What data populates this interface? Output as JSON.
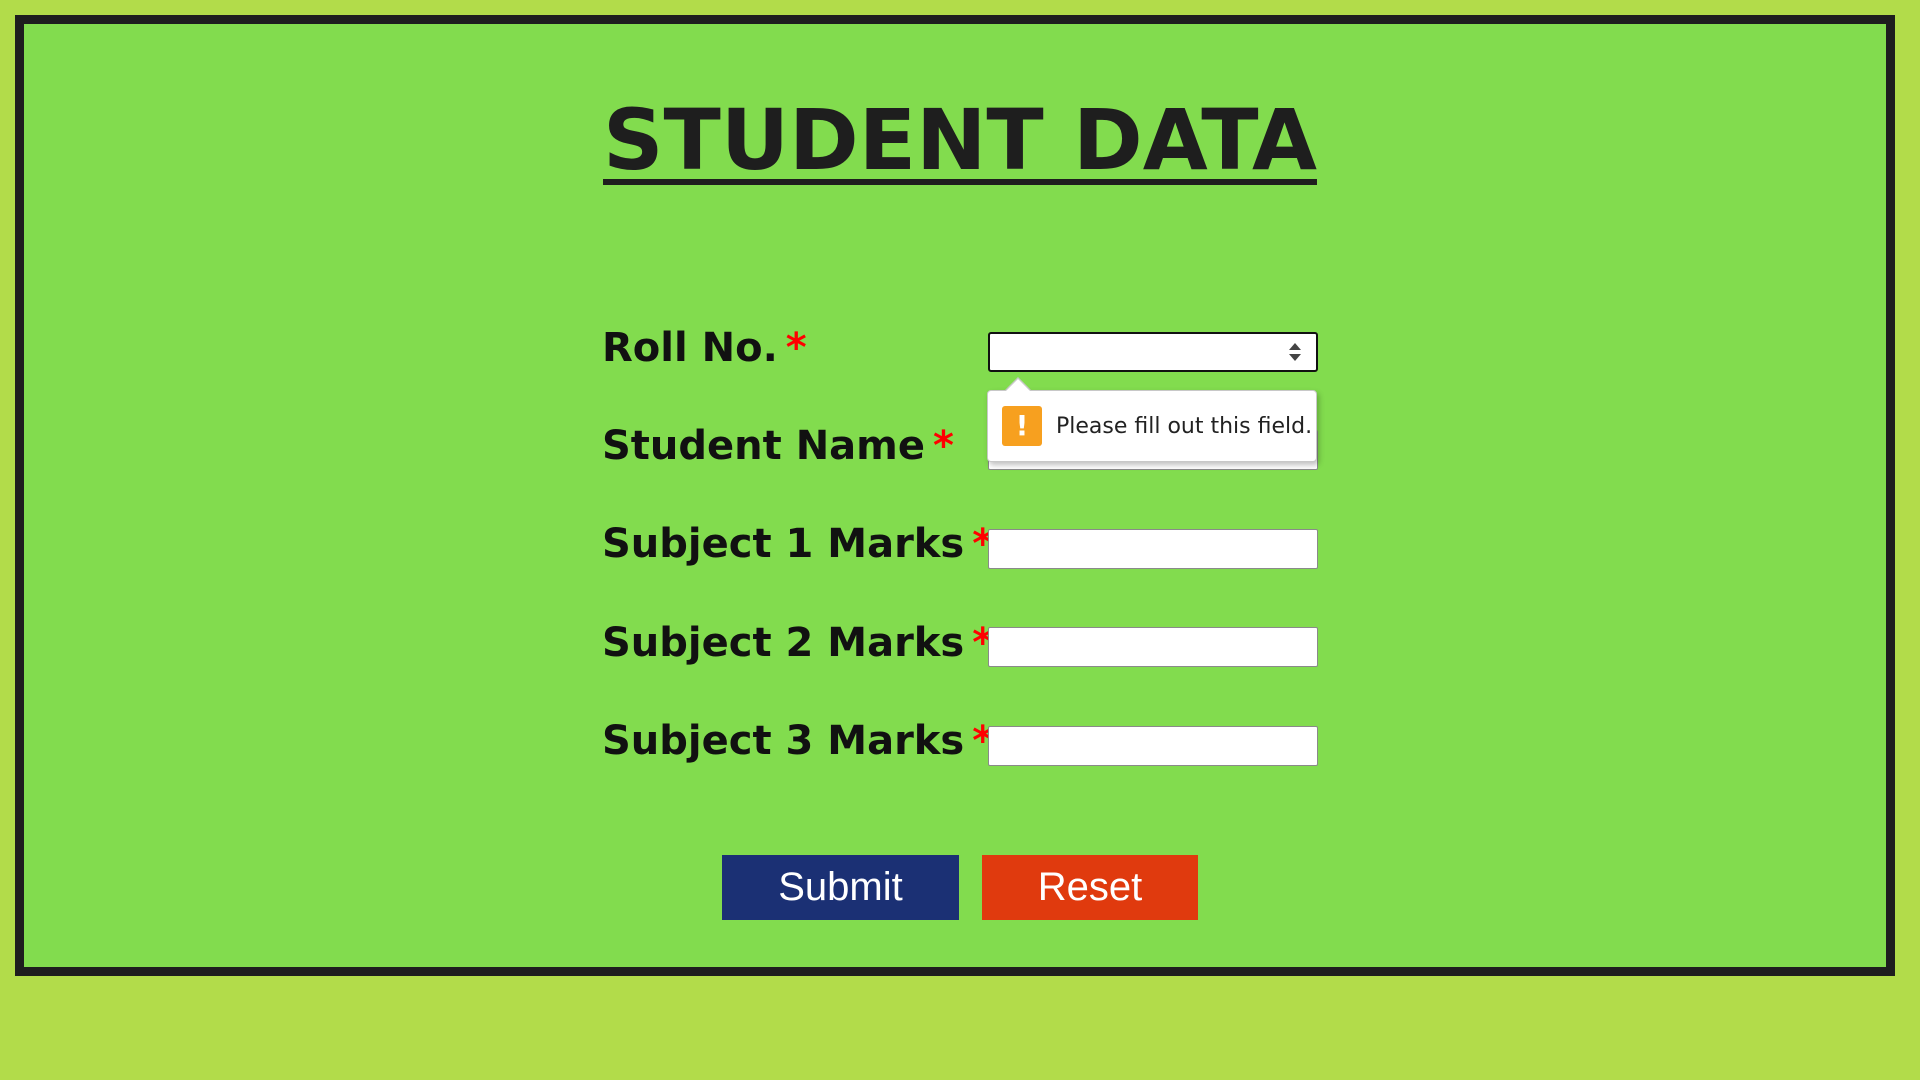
{
  "page": {
    "title": "STUDENT DATA"
  },
  "form": {
    "required_marker": "*",
    "fields": [
      {
        "label": "Roll No.",
        "value": "",
        "type": "number"
      },
      {
        "label": "Student Name",
        "value": "",
        "type": "text"
      },
      {
        "label": "Subject 1 Marks",
        "value": "",
        "type": "text"
      },
      {
        "label": "Subject 2 Marks",
        "value": "",
        "type": "text"
      },
      {
        "label": "Subject 3 Marks",
        "value": "",
        "type": "text"
      }
    ],
    "validation_message": "Please fill out this field.",
    "validation_icon": "warning-exclamation-icon",
    "submit_label": "Submit",
    "reset_label": "Reset"
  },
  "colors": {
    "page_background": "#b2dc4a",
    "panel_background": "#82dc4e",
    "panel_border": "#1e1e1e",
    "required_marker": "#ff0000",
    "submit_button": "#1b3074",
    "reset_button": "#e03a0e",
    "warning_icon": "#f7a01f"
  }
}
